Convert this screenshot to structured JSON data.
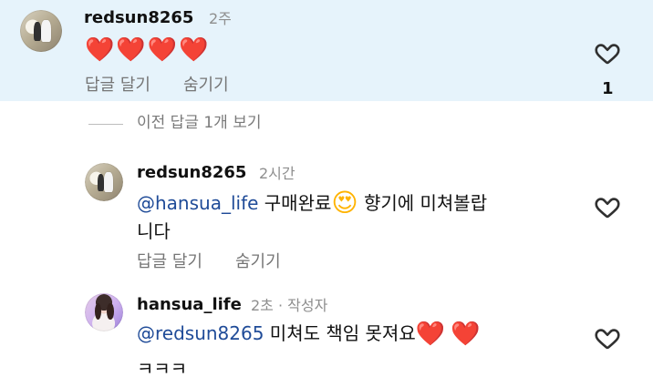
{
  "comments": [
    {
      "username": "redsun8265",
      "time": "2주",
      "hearts": "❤️❤️❤️❤️",
      "actions": {
        "reply": "답글 달기",
        "hide": "숨기기"
      },
      "like_count": "1",
      "avatar_icon": "wedding-photo-avatar"
    },
    {
      "username": "redsun8265",
      "time": "2시간",
      "mention": "@hansua_life",
      "text_before_emoji": " 구매완료",
      "emoji": "😍",
      "text_after_emoji": "  향기에 미쳐볼랍",
      "text_line2": "니다",
      "actions": {
        "reply": "답글 달기",
        "hide": "숨기기"
      },
      "avatar_icon": "wedding-photo-avatar"
    },
    {
      "username": "hansua_life",
      "time": "2초",
      "author_label": " · 작성자",
      "mention": "@redsun8265",
      "text_before_emoji": " 미쳐도 책임 못져요",
      "emoji_1": "❤️",
      "emoji_2": "❤️",
      "text_line2": "ㅋㅋㅋ",
      "avatar_icon": "profile-avatar"
    }
  ],
  "thread": {
    "view_previous_replies": "이전 답글 1개 보기"
  },
  "colors": {
    "highlight": "#e6f3fb",
    "mention": "#1f4b98",
    "muted": "#8e8e8e",
    "heart_red": "#ea1b2f"
  }
}
